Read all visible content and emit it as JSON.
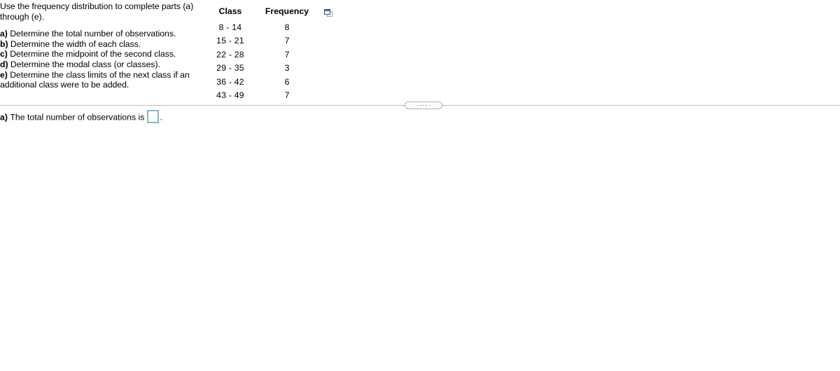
{
  "question": {
    "intro": "Use the frequency distribution to complete parts (a) through (e).",
    "parts": [
      {
        "label": "a)",
        "text": "Determine the total number of observations."
      },
      {
        "label": "b)",
        "text": "Determine the width of each class."
      },
      {
        "label": "c)",
        "text": "Determine the midpoint of the second class."
      },
      {
        "label": "d)",
        "text": "Determine the modal class (or classes)."
      },
      {
        "label": "e)",
        "text": "Determine the class limits of the next class if an additional class were to be added."
      }
    ]
  },
  "table": {
    "headers": [
      "Class",
      "Frequency"
    ],
    "rows": [
      {
        "class": "8 - 14",
        "frequency": "8"
      },
      {
        "class": "15 - 21",
        "frequency": "7"
      },
      {
        "class": "22 - 28",
        "frequency": "7"
      },
      {
        "class": "29 - 35",
        "frequency": "3"
      },
      {
        "class": "36 - 42",
        "frequency": "6"
      },
      {
        "class": "43 - 49",
        "frequency": "7"
      }
    ],
    "popout_icon": "duplicate-window-icon"
  },
  "answer": {
    "label": "a)",
    "text_before": "The total number of observations is",
    "input_value": "",
    "input_placeholder": "",
    "text_after": "."
  },
  "divider": {
    "handle_icon": "drag-handle-dots",
    "dot_count": 5
  },
  "colors": {
    "answer_box_border": "#8fb4c4",
    "divider_rule": "#b9b9b9",
    "icon_border": "#3f4c6b",
    "text": "#000000"
  }
}
